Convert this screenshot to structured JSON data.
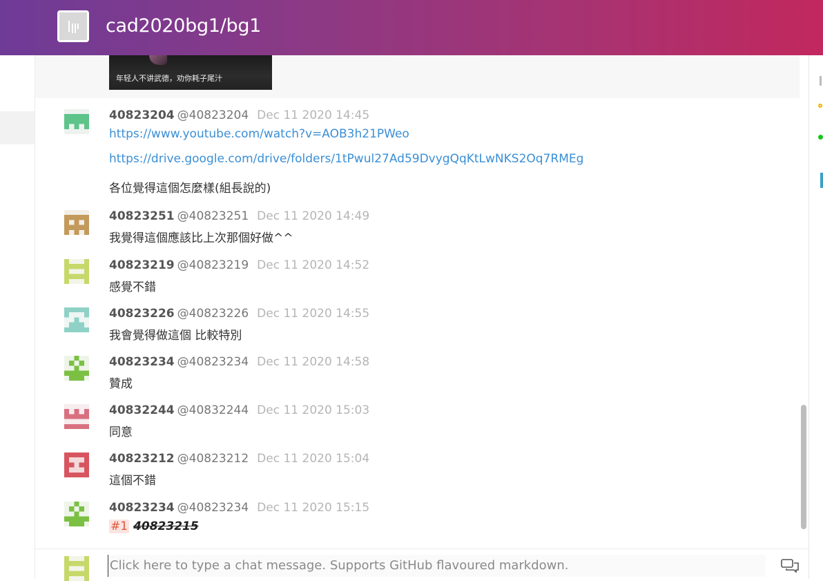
{
  "header": {
    "room_title": "cad2020bg1/bg1",
    "room_avatar_icon": "room-logo-icon",
    "gradient_start": "#6e3b97",
    "gradient_end": "#c1285d"
  },
  "previous_message": {
    "image_caption": "年轻人不讲武德，劝你耗子尾汁"
  },
  "messages": [
    {
      "display_name": "40823204",
      "username": "@40823204",
      "time": "Dec 11 2020 14:45",
      "lines": [
        "https://www.youtube.com/watch?v=AOB3h21PWeo",
        "https://drive.google.com/drive/folders/1tPwul27Ad59DvygQqKtLwNKS2Oq7RMEg",
        "各位覺得這個怎麼樣(組長說的)"
      ]
    },
    {
      "display_name": "40823251",
      "username": "@40823251",
      "time": "Dec 11 2020 14:49",
      "lines": [
        "我覺得這個應該比上次那個好做^^"
      ]
    },
    {
      "display_name": "40823219",
      "username": "@40823219",
      "time": "Dec 11 2020 14:52",
      "lines": [
        "感覺不錯"
      ]
    },
    {
      "display_name": "40823226",
      "username": "@40823226",
      "time": "Dec 11 2020 14:55",
      "lines": [
        "我會覺得做這個 比較特別"
      ]
    },
    {
      "display_name": "40823234",
      "username": "@40823234",
      "time": "Dec 11 2020 14:58",
      "lines": [
        "贊成"
      ]
    },
    {
      "display_name": "40832244",
      "username": "@40832244",
      "time": "Dec 11 2020 15:03",
      "lines": [
        "同意"
      ]
    },
    {
      "display_name": "40823212",
      "username": "@40823212",
      "time": "Dec 11 2020 15:04",
      "lines": [
        "這個不錯"
      ]
    },
    {
      "display_name": "40823234",
      "username": "@40823234",
      "time": "Dec 11 2020 15:15",
      "ref": "#1",
      "struck": "40823215"
    }
  ],
  "composer": {
    "placeholder": "Click here to type a chat message. Supports GitHub flavoured markdown.",
    "icon": "chat-bubbles-icon"
  },
  "colors": {
    "link": "#3a8fd6",
    "timestamp": "#b5b5b5",
    "reference": "#e0563b"
  }
}
